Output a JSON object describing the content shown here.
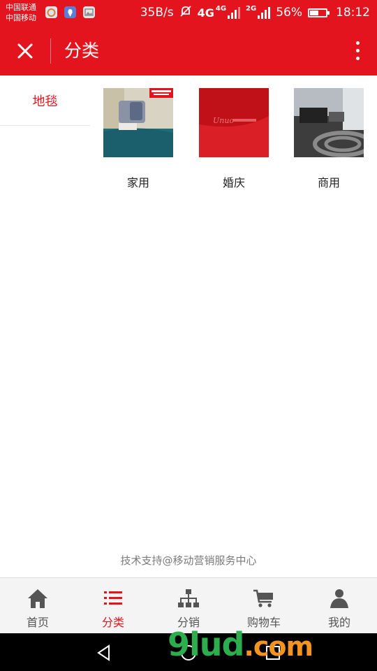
{
  "status_bar": {
    "carrier_1": "中国联通",
    "carrier_2": "中国移动",
    "speed": "35B/s",
    "net_4g": "4G",
    "net_4g_small": "4G",
    "net_2g": "2G",
    "battery": "56%",
    "battery_level": 0.56,
    "time": "18:12"
  },
  "header": {
    "title": "分类"
  },
  "sidebar": {
    "items": [
      {
        "label": "地毯",
        "active": true
      }
    ]
  },
  "categories": [
    {
      "label": "家用",
      "image_badge": "Dr. Valentino"
    },
    {
      "label": "婚庆",
      "image_text": "Unuo"
    },
    {
      "label": "商用"
    }
  ],
  "footer": {
    "credit": "技术支持@移动营销服务中心"
  },
  "bottom_nav": {
    "items": [
      {
        "label": "首页",
        "icon": "home-icon",
        "active": false
      },
      {
        "label": "分类",
        "icon": "list-icon",
        "active": true
      },
      {
        "label": "分销",
        "icon": "org-chart-icon",
        "active": false
      },
      {
        "label": "购物车",
        "icon": "cart-icon",
        "active": false
      },
      {
        "label": "我的",
        "icon": "user-icon",
        "active": false
      }
    ]
  },
  "watermark": {
    "text_1": "9lud",
    "text_2": ".com"
  },
  "colors": {
    "accent": "#e3141d",
    "nav_inactive": "#555555",
    "nav_bg": "#f4f4f4"
  }
}
